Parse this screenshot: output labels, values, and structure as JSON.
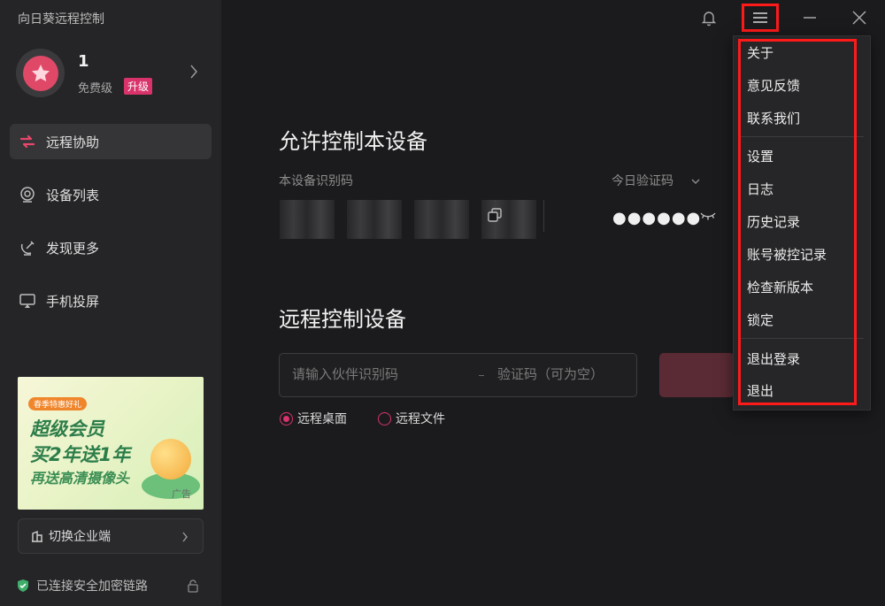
{
  "app": {
    "title": "向日葵远程控制"
  },
  "user": {
    "name": "1",
    "level": "免费级",
    "upgrade_label": "升级"
  },
  "sidebar": {
    "items": [
      {
        "label": "远程协助",
        "icon": "remote-assist-icon",
        "active": true
      },
      {
        "label": "设备列表",
        "icon": "device-list-icon",
        "active": false
      },
      {
        "label": "发现更多",
        "icon": "discover-icon",
        "active": false
      },
      {
        "label": "手机投屏",
        "icon": "screen-cast-icon",
        "active": false
      }
    ],
    "ad": {
      "tag": "春季特惠好礼",
      "line1": "超级会员",
      "line2": "买2年送1年",
      "line3": "再送高清摄像头",
      "label": "广告"
    },
    "switch_label": "切换企业端",
    "secure_status": "已连接安全加密链路"
  },
  "main": {
    "allow_section": {
      "title": "允许控制本设备",
      "device_id_label": "本设备识别码",
      "code_label": "今日验证码",
      "code_value": "●●●●●●"
    },
    "remote_section": {
      "title": "远程控制设备",
      "partner_placeholder": "请输入伙伴识别码",
      "code_placeholder": "验证码（可为空）",
      "options": [
        {
          "label": "远程桌面",
          "checked": true
        },
        {
          "label": "远程文件",
          "checked": false
        }
      ]
    }
  },
  "menu": {
    "groups": [
      [
        "关于",
        "意见反馈",
        "联系我们"
      ],
      [
        "设置",
        "日志",
        "历史记录",
        "账号被控记录",
        "检查新版本",
        "锁定"
      ],
      [
        "退出登录",
        "退出"
      ]
    ]
  },
  "colors": {
    "accent": "#d9336b",
    "highlight": "#ff1a1a",
    "sidebar_bg": "#252527",
    "main_bg": "#1b1b1d"
  }
}
